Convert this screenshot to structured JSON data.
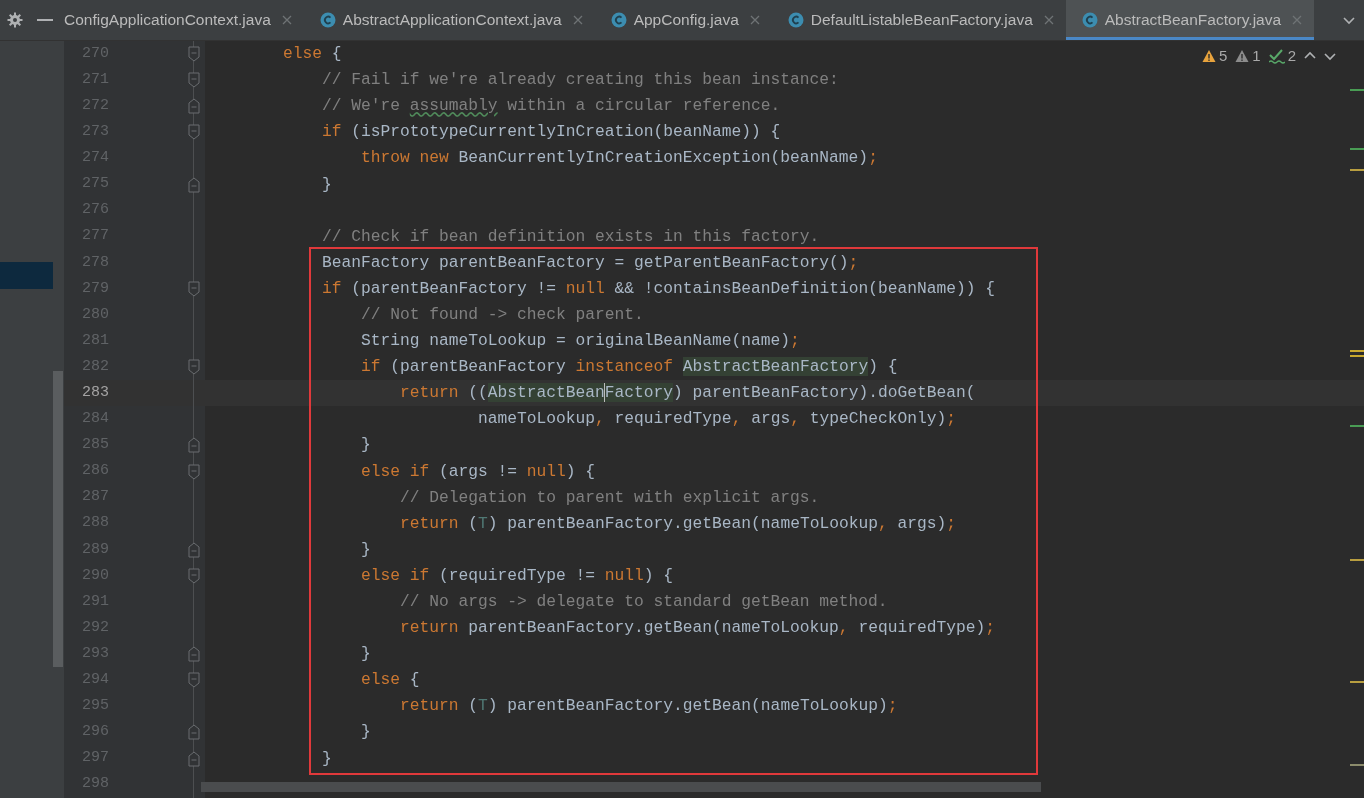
{
  "toolbar": {
    "buttons": [
      {
        "kind": "settings"
      },
      {
        "kind": "hide"
      }
    ]
  },
  "tabs": [
    {
      "label": "ConfigApplicationContext.java",
      "icon": false,
      "selected": false
    },
    {
      "label": "AbstractApplicationContext.java",
      "icon": true,
      "selected": false
    },
    {
      "label": "AppConfig.java",
      "icon": true,
      "selected": false
    },
    {
      "label": "DefaultListableBeanFactory.java",
      "icon": true,
      "selected": false
    },
    {
      "label": "AbstractBeanFactory.java",
      "icon": true,
      "selected": true
    }
  ],
  "inspections": [
    {
      "kind": "warning",
      "count": "5"
    },
    {
      "kind": "weak-warning",
      "count": "1"
    },
    {
      "kind": "typo",
      "count": "2"
    }
  ],
  "blocks": [
    {
      "boxed": false,
      "lines": [
        {
          "number": "270",
          "fold_start": true,
          "fold_end": false,
          "current": false,
          "tokens": [
            {
              "kind": "kw",
              "text": "        else"
            },
            {
              "kind": "plain",
              "text": " {"
            }
          ]
        },
        {
          "number": "271",
          "fold_start": true,
          "fold_end": false,
          "current": false,
          "tokens": [
            {
              "kind": "comment",
              "text": "            // Fail if we're already creating this bean instance:"
            }
          ]
        },
        {
          "number": "272",
          "fold_start": false,
          "fold_end": true,
          "current": false,
          "tokens": [
            {
              "kind": "comment",
              "text": "            // We're "
            },
            {
              "kind": "typo",
              "text": "assumably"
            },
            {
              "kind": "comment",
              "text": " within a circular reference."
            }
          ]
        },
        {
          "number": "273",
          "fold_start": true,
          "fold_end": false,
          "current": false,
          "tokens": [
            {
              "kind": "kw",
              "text": "            if"
            },
            {
              "kind": "plain",
              "text": " (isPrototypeCurrentlyInCreation(beanName)) {"
            }
          ]
        },
        {
          "number": "274",
          "fold_start": false,
          "fold_end": false,
          "current": false,
          "tokens": [
            {
              "kind": "kw",
              "text": "                throw new"
            },
            {
              "kind": "plain",
              "text": " BeanCurrentlyInCreationException(beanName)"
            },
            {
              "kind": "kw",
              "text": ";"
            }
          ]
        },
        {
          "number": "275",
          "fold_start": false,
          "fold_end": true,
          "current": false,
          "tokens": [
            {
              "kind": "plain",
              "text": "            }"
            }
          ]
        },
        {
          "number": "276",
          "fold_start": false,
          "fold_end": false,
          "current": false
        },
        {
          "number": "277",
          "fold_start": false,
          "fold_end": false,
          "current": false,
          "tokens": [
            {
              "kind": "comment",
              "text": "            // Check if bean definition exists in this factory."
            }
          ]
        }
      ]
    },
    {
      "boxed": true,
      "lines": [
        {
          "number": "278",
          "fold_start": false,
          "fold_end": false,
          "current": false,
          "tokens": [
            {
              "kind": "plain",
              "text": "            BeanFactory parentBeanFactory = getParentBeanFactory()"
            },
            {
              "kind": "kw",
              "text": ";"
            }
          ]
        },
        {
          "number": "279",
          "fold_start": true,
          "fold_end": false,
          "current": false,
          "tokens": [
            {
              "kind": "kw",
              "text": "            if"
            },
            {
              "kind": "plain",
              "text": " (parentBeanFactory != "
            },
            {
              "kind": "kw",
              "text": "null"
            },
            {
              "kind": "plain",
              "text": " && !containsBeanDefinition(beanName)) {"
            }
          ]
        },
        {
          "number": "280",
          "fold_start": false,
          "fold_end": false,
          "current": false,
          "tokens": [
            {
              "kind": "comment",
              "text": "                // Not found -> check parent."
            }
          ]
        },
        {
          "number": "281",
          "fold_start": false,
          "fold_end": false,
          "current": false,
          "tokens": [
            {
              "kind": "plain",
              "text": "                String nameToLookup = originalBeanName(name)"
            },
            {
              "kind": "kw",
              "text": ";"
            }
          ]
        },
        {
          "number": "282",
          "fold_start": true,
          "fold_end": false,
          "current": false,
          "tokens": [
            {
              "kind": "kw",
              "text": "                if"
            },
            {
              "kind": "plain",
              "text": " (parentBeanFactory "
            },
            {
              "kind": "kw",
              "text": "instanceof "
            },
            {
              "kind": "ref",
              "text": "AbstractBeanFactory"
            },
            {
              "kind": "plain",
              "text": ") {"
            }
          ]
        },
        {
          "number": "283",
          "fold_start": false,
          "fold_end": false,
          "current": true,
          "tokens": [
            {
              "kind": "kw",
              "text": "                    return"
            },
            {
              "kind": "plain",
              "text": " (("
            },
            {
              "kind": "ref",
              "text": "AbstractBean",
              "caret_after": true
            },
            {
              "kind": "ref",
              "text": "Factory"
            },
            {
              "kind": "plain",
              "text": ") parentBeanFactory).doGetBean("
            }
          ]
        },
        {
          "number": "284",
          "fold_start": false,
          "fold_end": false,
          "current": false,
          "tokens": [
            {
              "kind": "plain",
              "text": "                            nameToLookup"
            },
            {
              "kind": "kw",
              "text": ","
            },
            {
              "kind": "plain",
              "text": " requiredType"
            },
            {
              "kind": "kw",
              "text": ","
            },
            {
              "kind": "plain",
              "text": " args"
            },
            {
              "kind": "kw",
              "text": ","
            },
            {
              "kind": "plain",
              "text": " typeCheckOnly)"
            },
            {
              "kind": "kw",
              "text": ";"
            }
          ]
        },
        {
          "number": "285",
          "fold_start": false,
          "fold_end": true,
          "current": false,
          "tokens": [
            {
              "kind": "plain",
              "text": "                }"
            }
          ]
        },
        {
          "number": "286",
          "fold_start": true,
          "fold_end": false,
          "current": false,
          "tokens": [
            {
              "kind": "kw",
              "text": "                else if"
            },
            {
              "kind": "plain",
              "text": " (args != "
            },
            {
              "kind": "kw",
              "text": "null"
            },
            {
              "kind": "plain",
              "text": ") {"
            }
          ]
        },
        {
          "number": "287",
          "fold_start": false,
          "fold_end": false,
          "current": false,
          "tokens": [
            {
              "kind": "comment",
              "text": "                    // Delegation to parent with explicit args."
            }
          ]
        },
        {
          "number": "288",
          "fold_start": false,
          "fold_end": false,
          "current": false,
          "tokens": [
            {
              "kind": "kw",
              "text": "                    return"
            },
            {
              "kind": "plain",
              "text": " ("
            },
            {
              "kind": "generic",
              "text": "T"
            },
            {
              "kind": "plain",
              "text": ") parentBeanFactory.getBean(nameToLookup"
            },
            {
              "kind": "kw",
              "text": ","
            },
            {
              "kind": "plain",
              "text": " args)"
            },
            {
              "kind": "kw",
              "text": ";"
            }
          ]
        },
        {
          "number": "289",
          "fold_start": false,
          "fold_end": true,
          "current": false,
          "tokens": [
            {
              "kind": "plain",
              "text": "                }"
            }
          ]
        },
        {
          "number": "290",
          "fold_start": true,
          "fold_end": false,
          "current": false,
          "tokens": [
            {
              "kind": "kw",
              "text": "                else if"
            },
            {
              "kind": "plain",
              "text": " (requiredType != "
            },
            {
              "kind": "kw",
              "text": "null"
            },
            {
              "kind": "plain",
              "text": ") {"
            }
          ]
        },
        {
          "number": "291",
          "fold_start": false,
          "fold_end": false,
          "current": false,
          "tokens": [
            {
              "kind": "comment",
              "text": "                    // No args -> delegate to standard getBean method."
            }
          ]
        },
        {
          "number": "292",
          "fold_start": false,
          "fold_end": false,
          "current": false,
          "tokens": [
            {
              "kind": "kw",
              "text": "                    return"
            },
            {
              "kind": "plain",
              "text": " parentBeanFactory.getBean(nameToLookup"
            },
            {
              "kind": "kw",
              "text": ","
            },
            {
              "kind": "plain",
              "text": " requiredType)"
            },
            {
              "kind": "kw",
              "text": ";"
            }
          ]
        },
        {
          "number": "293",
          "fold_start": false,
          "fold_end": true,
          "current": false,
          "tokens": [
            {
              "kind": "plain",
              "text": "                }"
            }
          ]
        },
        {
          "number": "294",
          "fold_start": true,
          "fold_end": false,
          "current": false,
          "tokens": [
            {
              "kind": "kw",
              "text": "                else"
            },
            {
              "kind": "plain",
              "text": " {"
            }
          ]
        },
        {
          "number": "295",
          "fold_start": false,
          "fold_end": false,
          "current": false,
          "tokens": [
            {
              "kind": "kw",
              "text": "                    return"
            },
            {
              "kind": "plain",
              "text": " ("
            },
            {
              "kind": "generic",
              "text": "T"
            },
            {
              "kind": "plain",
              "text": ") parentBeanFactory.getBean(nameToLookup)"
            },
            {
              "kind": "kw",
              "text": ";"
            }
          ]
        },
        {
          "number": "296",
          "fold_start": false,
          "fold_end": true,
          "current": false,
          "tokens": [
            {
              "kind": "plain",
              "text": "                }"
            }
          ]
        },
        {
          "number": "297",
          "fold_start": false,
          "fold_end": true,
          "current": false,
          "tokens": [
            {
              "kind": "plain",
              "text": "            }"
            }
          ]
        }
      ]
    },
    {
      "boxed": false,
      "lines": [
        {
          "number": "298",
          "fold_start": false,
          "fold_end": false,
          "current": false
        }
      ]
    }
  ]
}
